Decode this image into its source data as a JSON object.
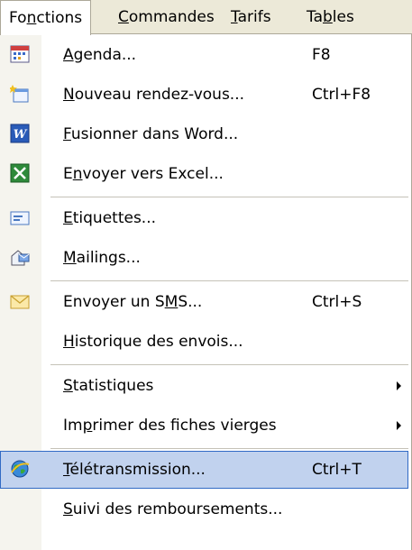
{
  "menubar": {
    "items": [
      {
        "label": "Fonctions",
        "pre": "Fo",
        "acc": "n",
        "post": "ctions"
      },
      {
        "label": "Commandes",
        "pre": "",
        "acc": "C",
        "post": "ommandes"
      },
      {
        "label": "Tarifs",
        "pre": "",
        "acc": "T",
        "post": "arifs"
      },
      {
        "label": "Tables",
        "pre": "Ta",
        "acc": "b",
        "post": "les"
      }
    ]
  },
  "menu": {
    "items": [
      {
        "icon": "calendar-icon",
        "pre": "",
        "acc": "A",
        "post": "genda...",
        "shortcut": "F8"
      },
      {
        "icon": "new-appointment-icon",
        "pre": "",
        "acc": "N",
        "post": "ouveau rendez-vous...",
        "shortcut": "Ctrl+F8"
      },
      {
        "icon": "word-icon",
        "pre": "",
        "acc": "F",
        "post": "usionner dans Word...",
        "shortcut": ""
      },
      {
        "icon": "excel-icon",
        "pre": "E",
        "acc": "n",
        "post": "voyer vers Excel...",
        "shortcut": ""
      },
      {
        "icon": "label-icon",
        "pre": "",
        "acc": "E",
        "post": "tiquettes...",
        "shortcut": ""
      },
      {
        "icon": "mailing-icon",
        "pre": "",
        "acc": "M",
        "post": "ailings...",
        "shortcut": ""
      },
      {
        "icon": "envelope-icon",
        "pre": "Envoyer un S",
        "acc": "M",
        "post": "S...",
        "shortcut": "Ctrl+S"
      },
      {
        "icon": "",
        "pre": "",
        "acc": "H",
        "post": "istorique des envois...",
        "shortcut": ""
      },
      {
        "icon": "",
        "pre": "",
        "acc": "S",
        "post": "tatistiques",
        "shortcut": ""
      },
      {
        "icon": "",
        "pre": "Im",
        "acc": "p",
        "post": "rimer des fiches vierges",
        "shortcut": ""
      },
      {
        "icon": "globe-transmission-icon",
        "pre": "",
        "acc": "T",
        "post": "élétransmission...",
        "shortcut": "Ctrl+T"
      },
      {
        "icon": "",
        "pre": "",
        "acc": "S",
        "post": "uivi des remboursements...",
        "shortcut": ""
      }
    ]
  },
  "colors": {
    "menubar_bg": "#ece9d8",
    "highlight_bg": "#c1d2ee",
    "highlight_border": "#316ac5",
    "gutter_bg": "#f5f4ee"
  }
}
